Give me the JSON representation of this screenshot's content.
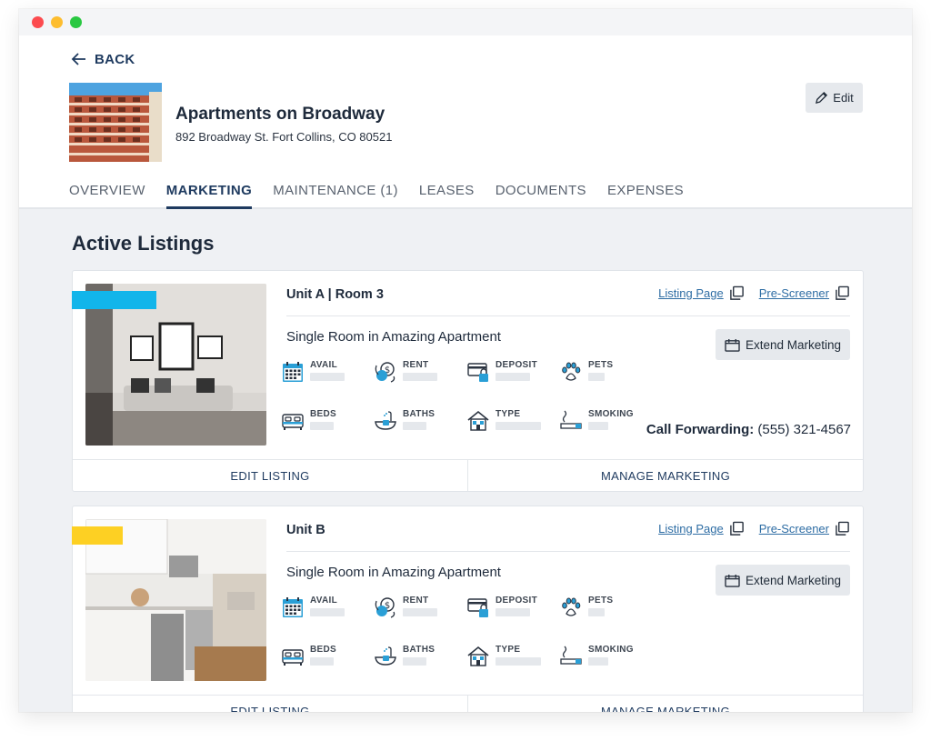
{
  "header": {
    "back_label": "BACK",
    "edit_label": "Edit",
    "property_name": "Apartments on Broadway",
    "property_address": "892 Broadway St. Fort Collins, CO 80521"
  },
  "tabs": [
    {
      "label": "OVERVIEW",
      "active": false
    },
    {
      "label": "MARKETING",
      "active": true
    },
    {
      "label": "MAINTENANCE (1)",
      "active": false
    },
    {
      "label": "LEASES",
      "active": false
    },
    {
      "label": "DOCUMENTS",
      "active": false
    },
    {
      "label": "EXPENSES",
      "active": false
    }
  ],
  "section_title": "Active Listings",
  "listings": [
    {
      "unit": "Unit A | Room 3",
      "listing_page_label": "Listing Page",
      "prescreener_label": "Pre-Screener",
      "title": "Single Room in Amazing Apartment",
      "extend_label": "Extend Marketing",
      "badge_color": "#12b5ea",
      "features": {
        "avail": "AVAIL",
        "rent": "RENT",
        "deposit": "DEPOSIT",
        "pets": "PETS",
        "beds": "BEDS",
        "baths": "BATHS",
        "type": "TYPE",
        "smoking": "SMOKING"
      },
      "call_forwarding_label": "Call Forwarding:",
      "call_forwarding_number": "(555) 321-4567",
      "edit_listing_label": "EDIT LISTING",
      "manage_marketing_label": "MANAGE MARKETING"
    },
    {
      "unit": "Unit B",
      "listing_page_label": "Listing Page",
      "prescreener_label": "Pre-Screener",
      "title": "Single Room in Amazing Apartment",
      "extend_label": "Extend Marketing",
      "badge_color": "#fdd023",
      "features": {
        "avail": "AVAIL",
        "rent": "RENT",
        "deposit": "DEPOSIT",
        "pets": "PETS",
        "beds": "BEDS",
        "baths": "BATHS",
        "type": "TYPE",
        "smoking": "SMOKING"
      },
      "edit_listing_label": "EDIT LISTING",
      "manage_marketing_label": "MANAGE MARKETING"
    }
  ],
  "colors": {
    "accent": "#1e3a5f",
    "link": "#2e6da4",
    "icon_blue": "#2a9fd6"
  }
}
